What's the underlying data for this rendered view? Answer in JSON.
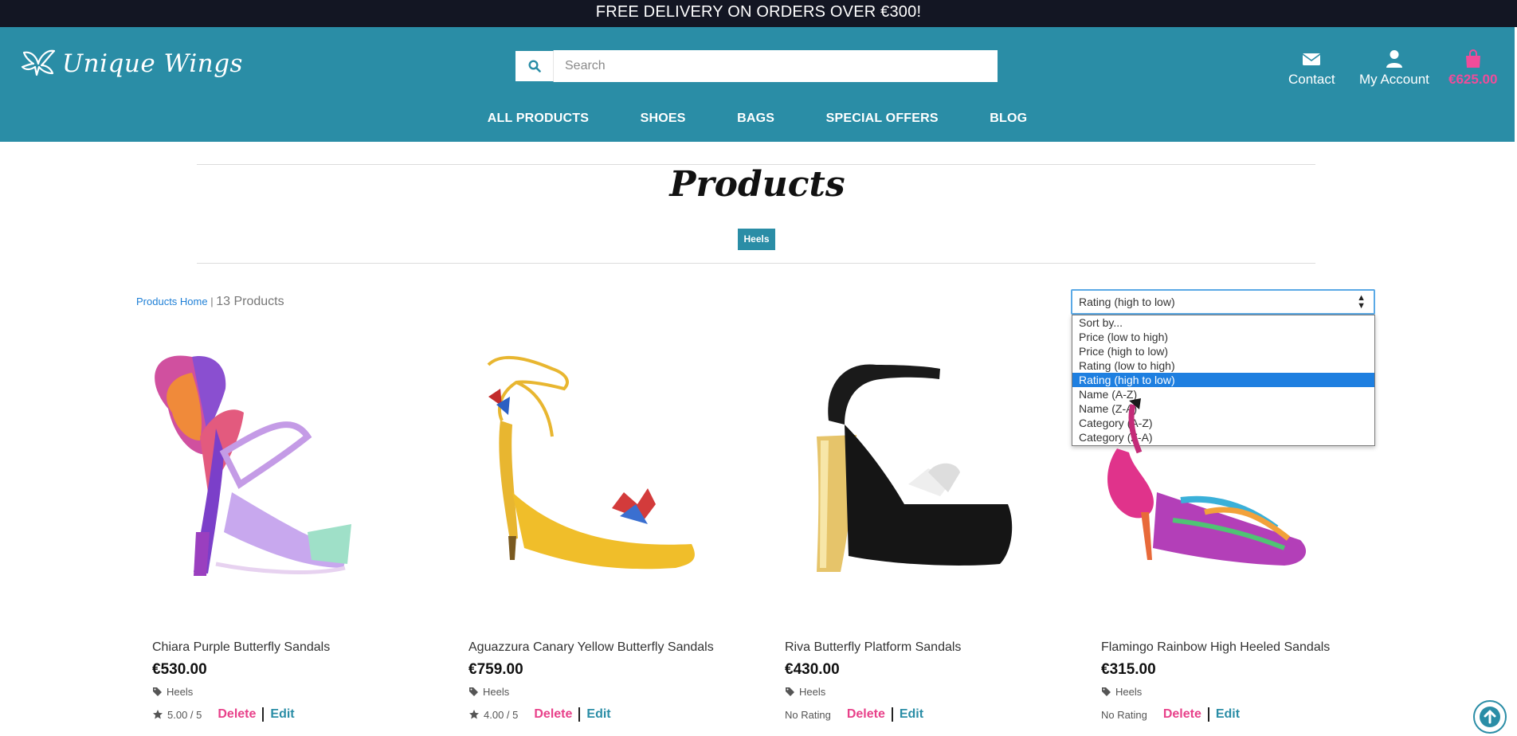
{
  "banner": {
    "text": "FREE DELIVERY ON ORDERS OVER €300!"
  },
  "logo": {
    "text": "Unique Wings"
  },
  "search": {
    "placeholder": "Search",
    "icon": "search-icon"
  },
  "header_links": {
    "contact": {
      "label": "Contact",
      "icon": "envelope-icon"
    },
    "account": {
      "label": "My Account",
      "icon": "user-icon"
    },
    "cart": {
      "label": "€625.00",
      "icon": "shopping-bag-icon"
    }
  },
  "nav": {
    "items": [
      "ALL PRODUCTS",
      "SHOES",
      "BAGS",
      "SPECIAL OFFERS",
      "BLOG"
    ]
  },
  "page": {
    "title": "Products",
    "category_badge": "Heels"
  },
  "breadcrumb": {
    "link": "Products Home",
    "separator": "|",
    "count": "13 Products"
  },
  "sort": {
    "selected": "Rating (high to low)",
    "options": [
      "Sort by...",
      "Price (low to high)",
      "Price (high to low)",
      "Rating (low to high)",
      "Rating (high to low)",
      "Name (A-Z)",
      "Name (Z-A)",
      "Category (A-Z)",
      "Category (Z-A)"
    ],
    "selected_index": 4
  },
  "products": [
    {
      "name": "Chiara Purple Butterfly Sandals",
      "price": "€530.00",
      "category": "Heels",
      "rating": "5.00 / 5",
      "delete": "Delete",
      "edit": "Edit"
    },
    {
      "name": "Aguazzura Canary Yellow Butterfly Sandals",
      "price": "€759.00",
      "category": "Heels",
      "rating": "4.00 / 5",
      "delete": "Delete",
      "edit": "Edit"
    },
    {
      "name": "Riva Butterfly Platform Sandals",
      "price": "€430.00",
      "category": "Heels",
      "rating": "No Rating",
      "delete": "Delete",
      "edit": "Edit"
    },
    {
      "name": "Flamingo Rainbow High Heeled Sandals",
      "price": "€315.00",
      "category": "Heels",
      "rating": "No Rating",
      "delete": "Delete",
      "edit": "Edit"
    }
  ],
  "colors": {
    "brand": "#2a8da6",
    "banner": "#131623",
    "accent_pink": "#f04c9a",
    "link_blue": "#1e7fd6"
  }
}
